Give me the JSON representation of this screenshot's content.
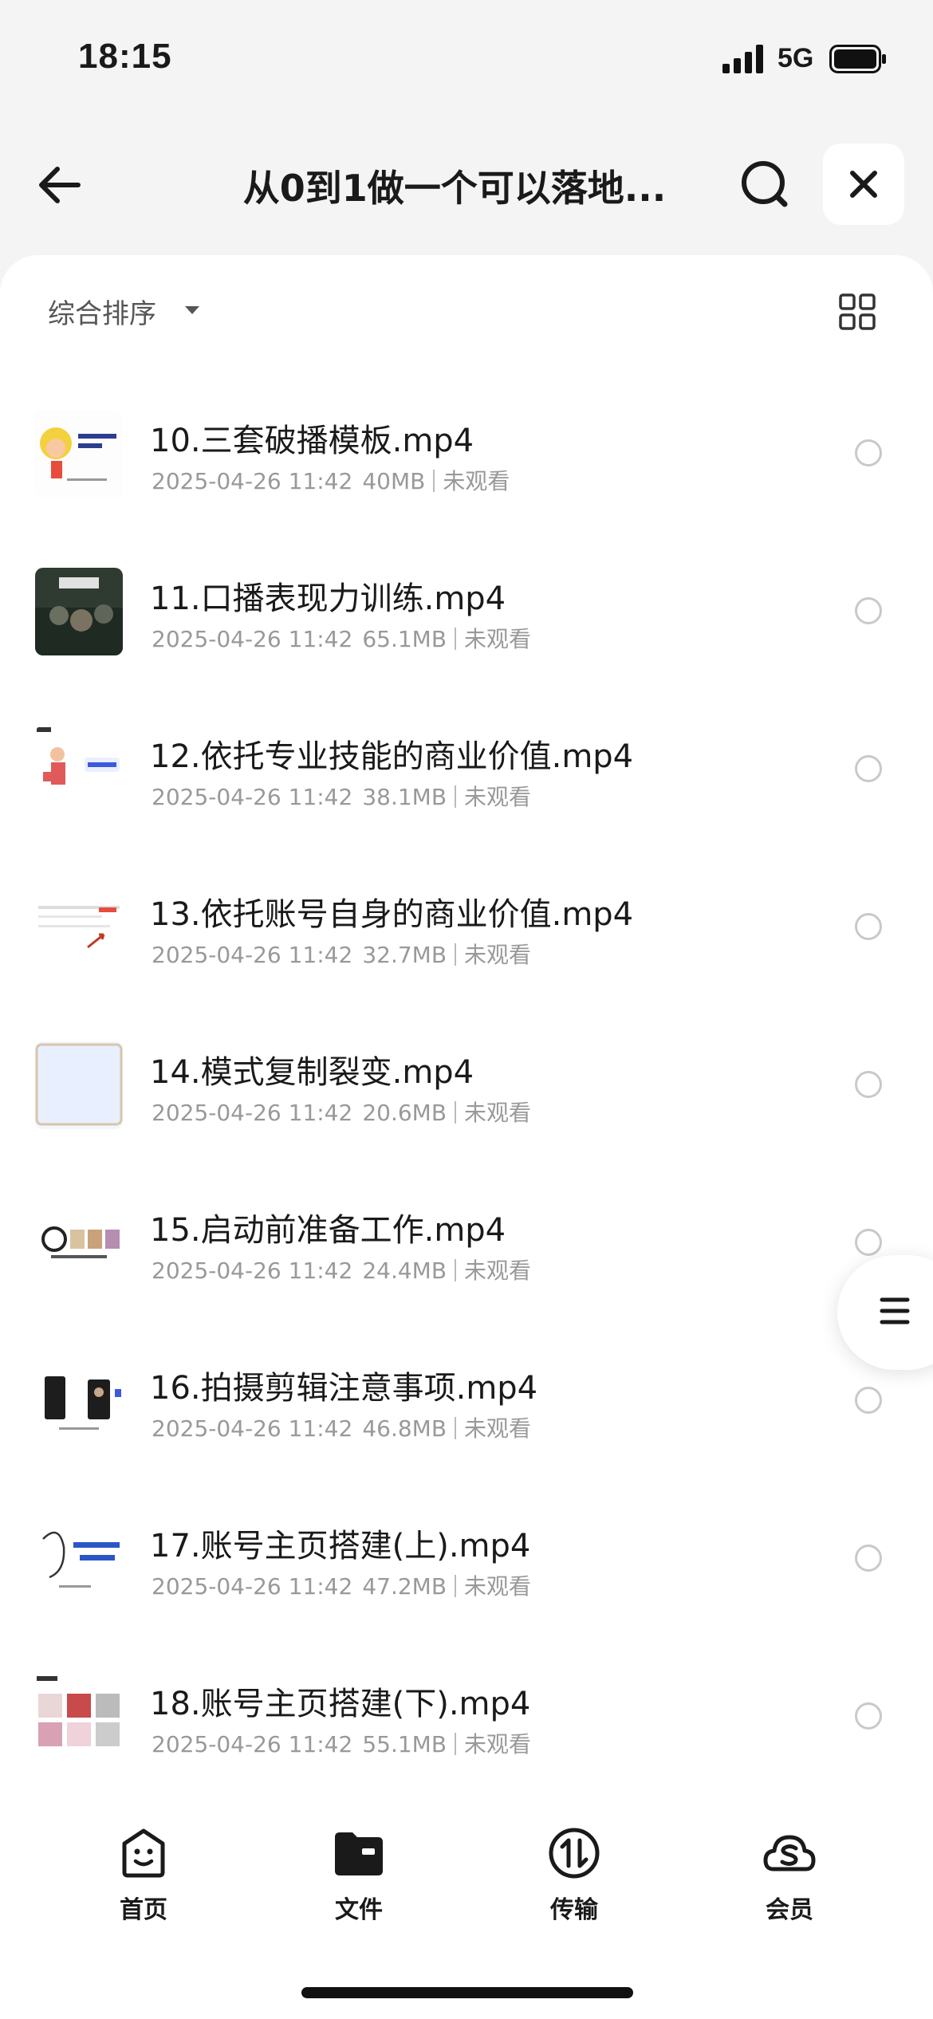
{
  "status": {
    "time": "18:15",
    "network": "5G"
  },
  "nav": {
    "title": "从0到1做一个可以落地..."
  },
  "toolbar": {
    "sort_label": "综合排序"
  },
  "files": [
    {
      "name": "10.三套破播模板.mp4",
      "date": "2025-04-26 11:42",
      "size": "40MB",
      "status": "未观看",
      "thumb": "cartoon"
    },
    {
      "name": "11.口播表现力训练.mp4",
      "date": "2025-04-26 11:42",
      "size": "65.1MB",
      "status": "未观看",
      "thumb": "dark"
    },
    {
      "name": "12.依托专业技能的商业价值.mp4",
      "date": "2025-04-26 11:42",
      "size": "38.1MB",
      "status": "未观看",
      "thumb": "figure"
    },
    {
      "name": "13.依托账号自身的商业价值.mp4",
      "date": "2025-04-26 11:42",
      "size": "32.7MB",
      "status": "未观看",
      "thumb": "chart"
    },
    {
      "name": "14.模式复制裂变.mp4",
      "date": "2025-04-26 11:42",
      "size": "20.6MB",
      "status": "未观看",
      "thumb": "blank"
    },
    {
      "name": "15.启动前准备工作.mp4",
      "date": "2025-04-26 11:42",
      "size": "24.4MB",
      "status": "未观看",
      "thumb": "slide"
    },
    {
      "name": "16.拍摄剪辑注意事项.mp4",
      "date": "2025-04-26 11:42",
      "size": "46.8MB",
      "status": "未观看",
      "thumb": "phones"
    },
    {
      "name": "17.账号主页搭建(上).mp4",
      "date": "2025-04-26 11:42",
      "size": "47.2MB",
      "status": "未观看",
      "thumb": "sketch"
    },
    {
      "name": "18.账号主页搭建(下).mp4",
      "date": "2025-04-26 11:42",
      "size": "55.1MB",
      "status": "未观看",
      "thumb": "grid"
    }
  ],
  "tabbar": [
    {
      "label": "首页",
      "icon": "smile-face-icon"
    },
    {
      "label": "文件",
      "icon": "folder-icon"
    },
    {
      "label": "传输",
      "icon": "transfer-icon"
    },
    {
      "label": "会员",
      "icon": "cloud-s-icon"
    }
  ],
  "colors": {
    "accent_text": "#1a1a1a",
    "meta_text": "#999999",
    "background": "#f4f4f5"
  }
}
